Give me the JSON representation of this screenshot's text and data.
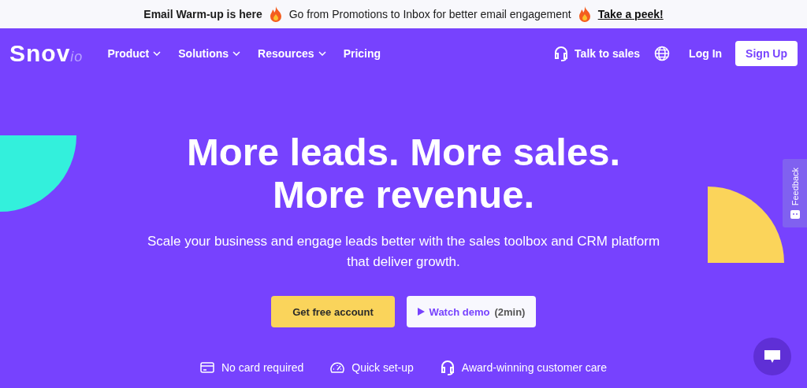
{
  "announcement": {
    "title": "Email Warm-up is here",
    "message": "Go from Promotions to Inbox for better email engagement",
    "link": "Take a peek!"
  },
  "nav": {
    "logo": "Snov",
    "logo_suffix": "io",
    "menu": [
      {
        "label": "Product",
        "dropdown": true
      },
      {
        "label": "Solutions",
        "dropdown": true
      },
      {
        "label": "Resources",
        "dropdown": true
      },
      {
        "label": "Pricing",
        "dropdown": false
      }
    ],
    "talk_to_sales": "Talk to sales",
    "login": "Log In",
    "signup": "Sign Up"
  },
  "hero": {
    "title_lines": [
      "More leads. More sales.",
      "More revenue."
    ],
    "subtitle": "Scale your business and engage leads better with the sales toolbox and CRM platform that deliver growth.",
    "primary_button": "Get free account",
    "secondary_button": "Watch demo",
    "secondary_note": "(2min)"
  },
  "features": [
    {
      "kind": "card",
      "label": "No card required"
    },
    {
      "kind": "speed",
      "label": "Quick set-up"
    },
    {
      "kind": "headset",
      "label": "Award-winning customer care"
    }
  ],
  "feedback_tab": "Feedback"
}
